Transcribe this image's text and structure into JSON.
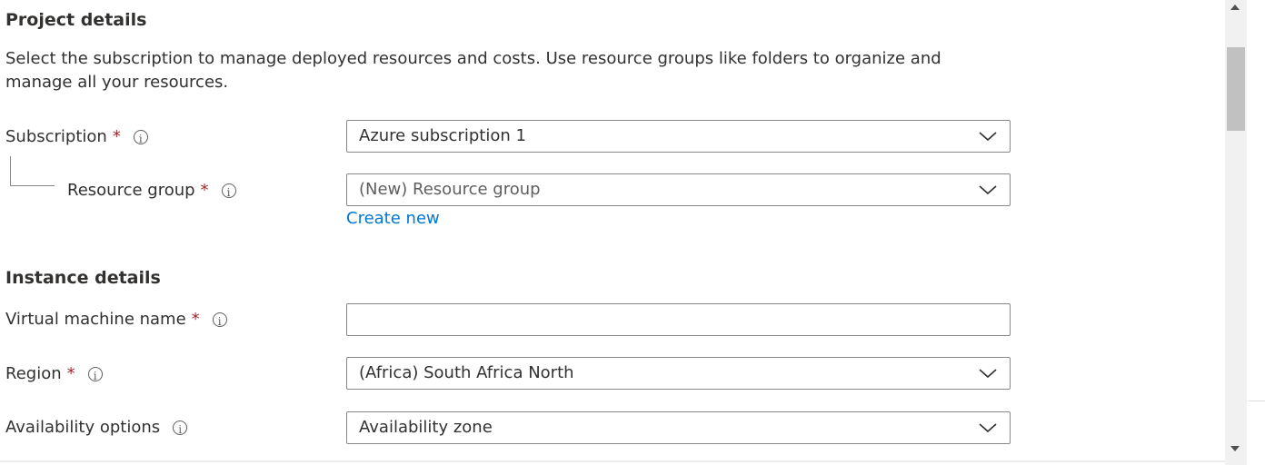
{
  "project": {
    "title": "Project details",
    "description": "Select the subscription to manage deployed resources and costs. Use resource groups like folders to organize and manage all your resources.",
    "subscription": {
      "label": "Subscription",
      "required": "*",
      "value": "Azure subscription 1"
    },
    "resource_group": {
      "label": "Resource group",
      "required": "*",
      "value": "(New) Resource group",
      "create_new": "Create new"
    }
  },
  "instance": {
    "title": "Instance details",
    "vm_name": {
      "label": "Virtual machine name",
      "required": "*",
      "value": ""
    },
    "region": {
      "label": "Region",
      "required": "*",
      "value": "(Africa) South Africa North"
    },
    "availability": {
      "label": "Availability options",
      "value": "Availability zone"
    }
  },
  "icons": {
    "info": "info-icon",
    "dropdown": "chevron-down-icon",
    "scroll_up": "scroll-up-arrow-icon",
    "scroll_down": "scroll-down-arrow-icon"
  },
  "colors": {
    "required": "#a4262c",
    "link": "#0078d4",
    "border": "#8a8886",
    "text": "#323130"
  }
}
